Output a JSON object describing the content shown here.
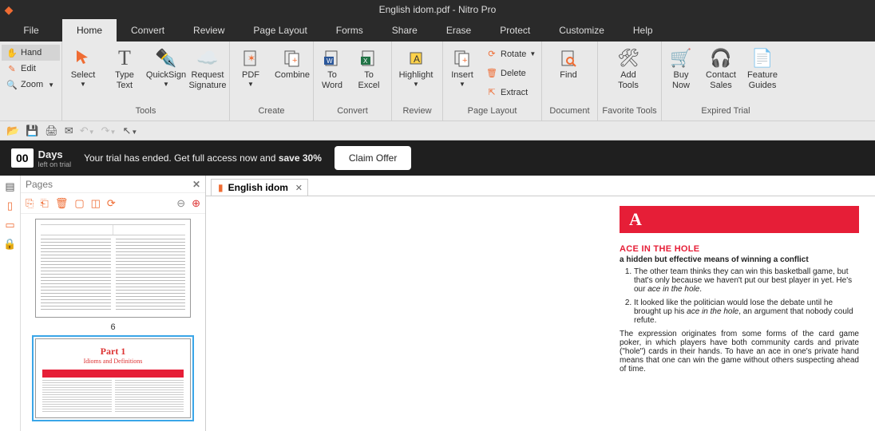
{
  "app": {
    "title": "English idom.pdf - Nitro Pro"
  },
  "menubar": {
    "file": "File",
    "tabs": [
      "Home",
      "Convert",
      "Review",
      "Page Layout",
      "Forms",
      "Share",
      "Erase",
      "Protect",
      "Customize",
      "Help"
    ],
    "active": 0
  },
  "leftpanel": {
    "hand": "Hand",
    "edit": "Edit",
    "zoom": "Zoom"
  },
  "ribbon": {
    "tools": {
      "caption": "Tools",
      "select": "Select",
      "typetext": "Type\nText",
      "quicksign": "QuickSign",
      "reqsig": "Request\nSignature"
    },
    "create": {
      "caption": "Create",
      "pdf": "PDF",
      "combine": "Combine"
    },
    "convert": {
      "caption": "Convert",
      "toword": "To\nWord",
      "toexcel": "To\nExcel"
    },
    "review": {
      "caption": "Review",
      "highlight": "Highlight"
    },
    "pagelayout": {
      "caption": "Page Layout",
      "insert": "Insert",
      "rotate": "Rotate",
      "delete": "Delete",
      "extract": "Extract"
    },
    "document": {
      "caption": "Document",
      "find": "Find"
    },
    "favtools": {
      "caption": "Favorite Tools",
      "addtools": "Add\nTools"
    },
    "expired": {
      "caption": "Expired Trial",
      "buynow": "Buy\nNow",
      "contact": "Contact\nSales",
      "guides": "Feature\nGuides"
    }
  },
  "trial": {
    "badge": "00",
    "days_label": "Days",
    "left_label": "left on trial",
    "msg_pre": "Your trial has ended. Get full access now and ",
    "msg_bold": "save 30%",
    "claim": "Claim Offer"
  },
  "pages": {
    "title": "Pages",
    "num1": "6"
  },
  "doctab": {
    "label": "English idom"
  },
  "doc": {
    "letter": "A",
    "idiom": "ACE IN THE HOLE",
    "def": "a hidden but effective means of winning a conflict",
    "ex1a": "The other team thinks they can win this basketball game, but that's only because we haven't put our best player in yet. He's our ",
    "ex1i": "ace in the hole",
    "ex1b": ".",
    "ex2a": "It looked like the politician would lose the debate until he brought up his ",
    "ex2i": "ace in the hole",
    "ex2b": ", an argument that nobody could refute.",
    "origin": "The expression originates from some forms of the card game poker, in which players have both community cards and private (\"hole\") cards in their hands. To have an ace in one's private hand means that one can win the game without others suspecting ahead of time."
  },
  "thumb2": {
    "part": "Part 1",
    "sub": "Idioms and Definitions"
  }
}
